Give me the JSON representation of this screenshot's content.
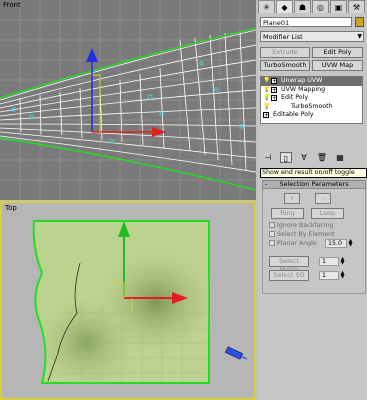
{
  "viewports": {
    "front_label": "Front",
    "top_label": "Top"
  },
  "command_panel": {
    "tabs": [
      {
        "name": "create-tab-icon",
        "glyph": "✳"
      },
      {
        "name": "modify-tab-icon",
        "glyph": "◆"
      },
      {
        "name": "hierarchy-tab-icon",
        "glyph": "☗"
      },
      {
        "name": "motion-tab-icon",
        "glyph": "◎"
      },
      {
        "name": "display-tab-icon",
        "glyph": "▣"
      },
      {
        "name": "utilities-tab-icon",
        "glyph": "⚒"
      }
    ],
    "object_name": "Plane01",
    "object_color": "#c9a426",
    "modifier_list_label": "Modifier List",
    "buttons": {
      "extrude": "Extrude",
      "edit_poly": "Edit Poly",
      "turbosmooth": "TurboSmooth",
      "uvw_map": "UVW Map"
    },
    "stack": [
      {
        "label": "Unwrap UVW",
        "selected": true,
        "plus": true,
        "bulb": true
      },
      {
        "label": "UVW Mapping",
        "selected": false,
        "plus": true,
        "bulb": true
      },
      {
        "label": "Edit Poly",
        "selected": false,
        "plus": true,
        "bulb": true
      },
      {
        "label": "TurboSmooth",
        "selected": false,
        "plus": false,
        "bulb": true
      },
      {
        "label": "Editable Poly",
        "selected": false,
        "plus": true,
        "bulb": false
      }
    ],
    "tooltip": "Show end result on/off toggle",
    "rollout_title": "Selection Parameters",
    "rollout_toggle": "-",
    "selection": {
      "plus": "+",
      "minus": "-",
      "ring": "Ring",
      "loop": "Loop",
      "ignore_backfacing": "Ignore Backfacing",
      "select_by_element": "Select By Element",
      "planar_angle": "Planar Angle",
      "planar_angle_value": "15.0",
      "select_mat_id": "Select MatID",
      "mat_id_value": "1",
      "select_sg": "Select SG",
      "sg_value": "1"
    }
  }
}
